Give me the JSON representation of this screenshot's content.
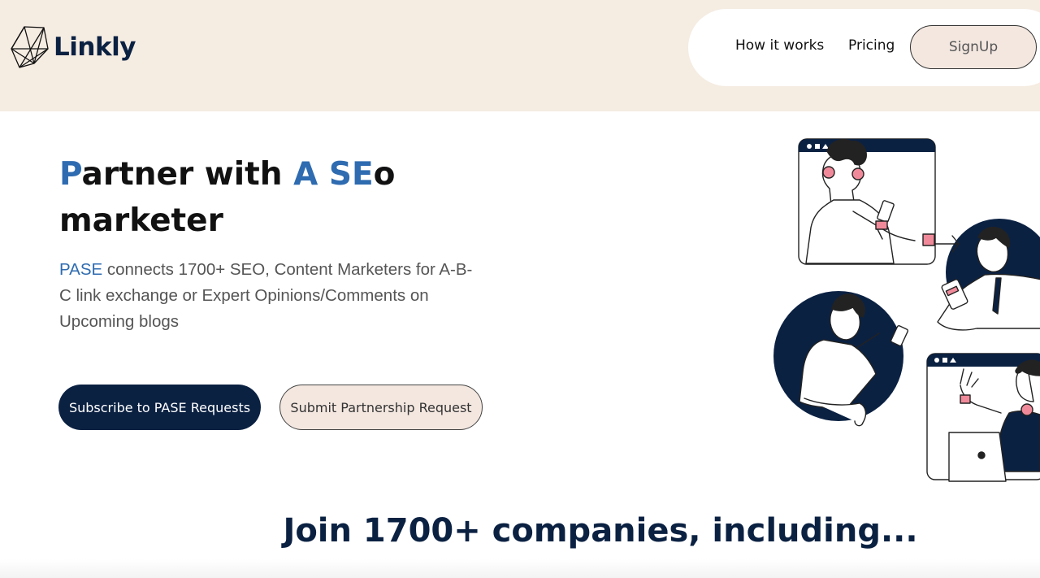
{
  "brand": {
    "name": "Linkly"
  },
  "nav": {
    "items": [
      {
        "label": "How it works"
      },
      {
        "label": "Pricing"
      }
    ],
    "signup_label": "SignUp"
  },
  "hero": {
    "title_part1_accent": "P",
    "title_part2": "artner with ",
    "title_part3_accent": "A SE",
    "title_part4": "o",
    "title_line2": "marketer",
    "description_accent": "PASE",
    "description_rest": " connects 1700+ SEO, Content Marketers for A-B-C link exchange or Expert Opinions/Comments on Upcoming blogs",
    "primary_button": "Subscribe to PASE Requests",
    "secondary_button": "Submit Partnership Request"
  },
  "companies": {
    "heading": "Join 1700+ companies, including..."
  },
  "colors": {
    "navy": "#0b2142",
    "accent_blue": "#2e6bb0",
    "header_bg": "#f5ece2",
    "pink": "#f08a9a"
  },
  "icons": [
    "logo-polyhedron-icon"
  ]
}
